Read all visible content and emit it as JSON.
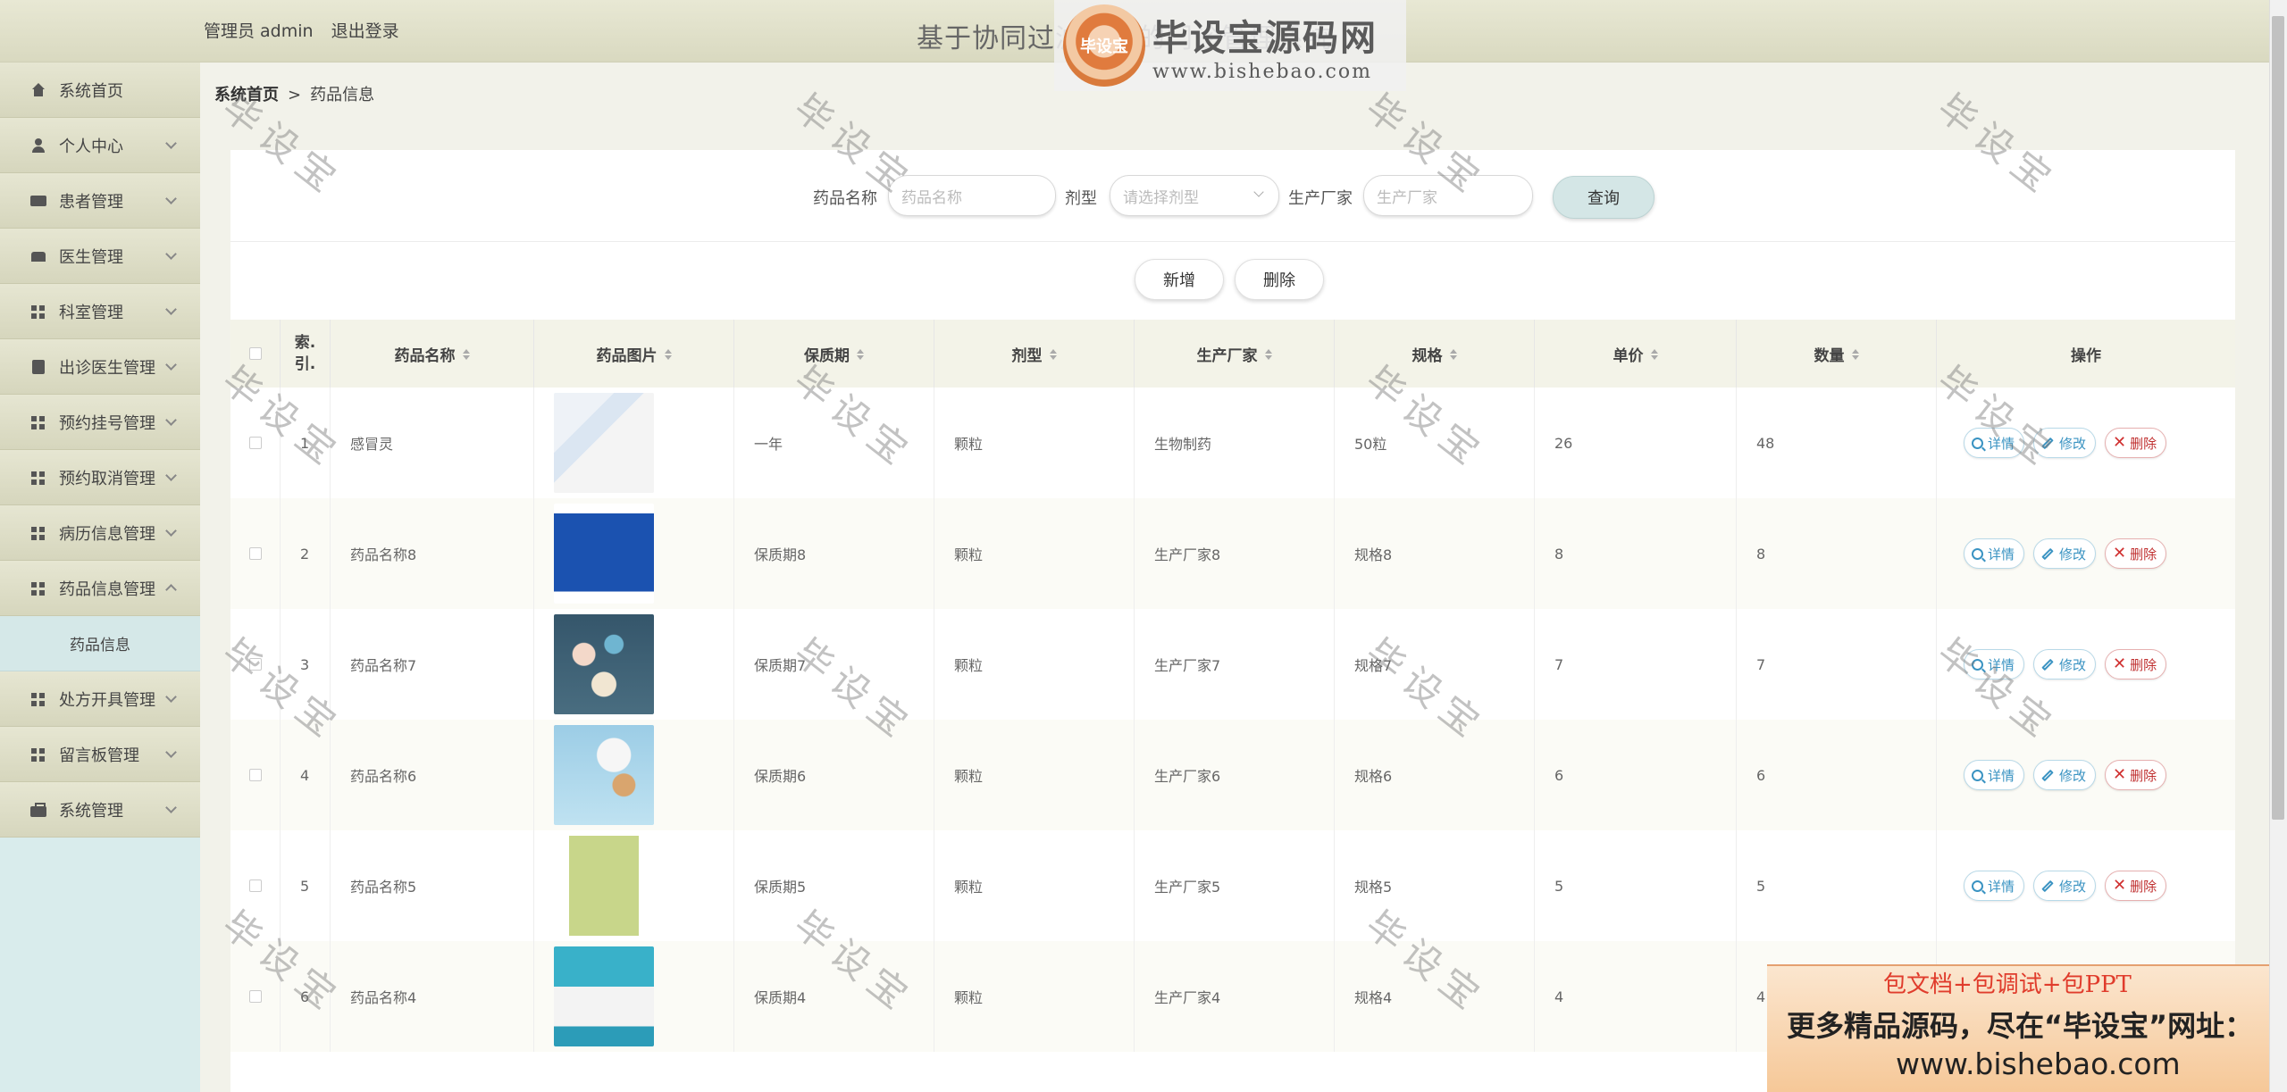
{
  "header": {
    "admin_label": "管理员 admin",
    "logout": "退出登录",
    "site_title": "基于协同过滤算法的门诊管理系统"
  },
  "logo": {
    "emblem": "毕设宝",
    "name": "毕设宝源码网",
    "url": "www.bishebao.com"
  },
  "sidebar": {
    "items": [
      {
        "label": "系统首页",
        "icon": "home-icon"
      },
      {
        "label": "个人中心",
        "icon": "user-icon"
      },
      {
        "label": "患者管理",
        "icon": "card-icon"
      },
      {
        "label": "医生管理",
        "icon": "bed-icon"
      },
      {
        "label": "科室管理",
        "icon": "grid-icon"
      },
      {
        "label": "出诊医生管理",
        "icon": "clipboard-icon"
      },
      {
        "label": "预约挂号管理",
        "icon": "grid-icon"
      },
      {
        "label": "预约取消管理",
        "icon": "grid-icon"
      },
      {
        "label": "病历信息管理",
        "icon": "grid-icon"
      },
      {
        "label": "药品信息管理",
        "icon": "grid-icon"
      },
      {
        "label": "处方开具管理",
        "icon": "grid-icon"
      },
      {
        "label": "留言板管理",
        "icon": "grid-icon"
      },
      {
        "label": "系统管理",
        "icon": "briefcase-icon"
      }
    ],
    "sub_item": "药品信息"
  },
  "breadcrumb": {
    "home": "系统首页",
    "sep": ">",
    "current": "药品信息"
  },
  "search": {
    "name_label": "药品名称",
    "name_placeholder": "药品名称",
    "type_label": "剂型",
    "type_placeholder": "请选择剂型",
    "maker_label": "生产厂家",
    "maker_placeholder": "生产厂家",
    "query": "查询"
  },
  "actions": {
    "add": "新增",
    "delete": "删除"
  },
  "table": {
    "headers": [
      "索引",
      "药品名称",
      "药品图片",
      "保质期",
      "剂型",
      "生产厂家",
      "规格",
      "单价",
      "数量",
      "操作"
    ],
    "index_header_top": "索.",
    "index_header_bottom": "引.",
    "rows": [
      {
        "idx": "1",
        "name": "感冒灵",
        "shelf": "一年",
        "form": "颗粒",
        "maker": "生物制药",
        "spec": "50粒",
        "price": "26",
        "qty": "48"
      },
      {
        "idx": "2",
        "name": "药品名称8",
        "shelf": "保质期8",
        "form": "颗粒",
        "maker": "生产厂家8",
        "spec": "规格8",
        "price": "8",
        "qty": "8"
      },
      {
        "idx": "3",
        "name": "药品名称7",
        "shelf": "保质期7",
        "form": "颗粒",
        "maker": "生产厂家7",
        "spec": "规格7",
        "price": "7",
        "qty": "7"
      },
      {
        "idx": "4",
        "name": "药品名称6",
        "shelf": "保质期6",
        "form": "颗粒",
        "maker": "生产厂家6",
        "spec": "规格6",
        "price": "6",
        "qty": "6"
      },
      {
        "idx": "5",
        "name": "药品名称5",
        "shelf": "保质期5",
        "form": "颗粒",
        "maker": "生产厂家5",
        "spec": "规格5",
        "price": "5",
        "qty": "5"
      },
      {
        "idx": "6",
        "name": "药品名称4",
        "shelf": "保质期4",
        "form": "颗粒",
        "maker": "生产厂家4",
        "spec": "规格4",
        "price": "4",
        "qty": "4"
      }
    ],
    "op_detail": "详情",
    "op_edit": "修改",
    "op_delete": "删除"
  },
  "watermark": "毕设宝",
  "promo": {
    "line1": "包文档+包调试+包PPT",
    "line2": "更多精品源码，尽在“毕设宝”网址：",
    "line3": "www.bishebao.com"
  }
}
